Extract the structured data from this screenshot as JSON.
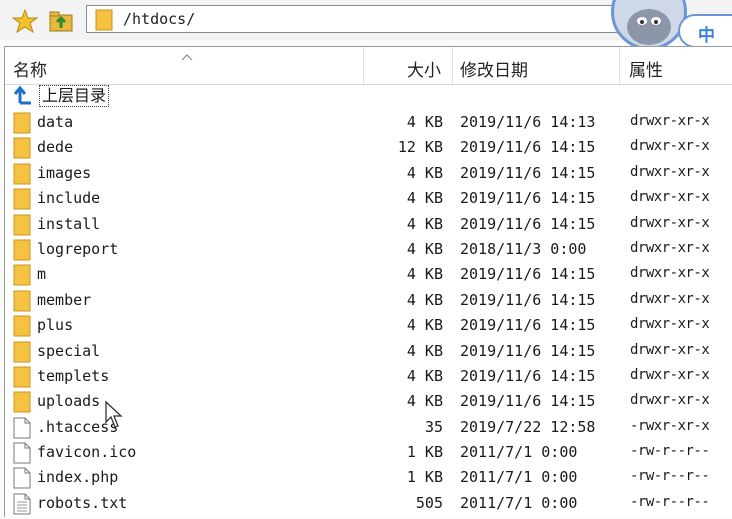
{
  "toolbar": {
    "path": "/htdocs/",
    "icons": [
      "star-icon",
      "up-folder-icon",
      "folder-icon"
    ]
  },
  "ime": {
    "mode_label": "中"
  },
  "header": {
    "name": "名称",
    "size": "大小",
    "modified": "修改日期",
    "attrs": "属性"
  },
  "parent_dir": {
    "label": "上层目录",
    "icon": "up-arrow-icon"
  },
  "files": [
    {
      "name": "data",
      "type": "folder",
      "size": "4 KB",
      "date": "2019/11/6 14:13",
      "perm": "drwxr-xr-x"
    },
    {
      "name": "dede",
      "type": "folder",
      "size": "12 KB",
      "date": "2019/11/6 14:15",
      "perm": "drwxr-xr-x"
    },
    {
      "name": "images",
      "type": "folder",
      "size": "4 KB",
      "date": "2019/11/6 14:15",
      "perm": "drwxr-xr-x"
    },
    {
      "name": "include",
      "type": "folder",
      "size": "4 KB",
      "date": "2019/11/6 14:15",
      "perm": "drwxr-xr-x"
    },
    {
      "name": "install",
      "type": "folder",
      "size": "4 KB",
      "date": "2019/11/6 14:15",
      "perm": "drwxr-xr-x"
    },
    {
      "name": "logreport",
      "type": "folder",
      "size": "4 KB",
      "date": "2018/11/3 0:00",
      "perm": "drwxr-xr-x"
    },
    {
      "name": "m",
      "type": "folder",
      "size": "4 KB",
      "date": "2019/11/6 14:15",
      "perm": "drwxr-xr-x"
    },
    {
      "name": "member",
      "type": "folder",
      "size": "4 KB",
      "date": "2019/11/6 14:15",
      "perm": "drwxr-xr-x"
    },
    {
      "name": "plus",
      "type": "folder",
      "size": "4 KB",
      "date": "2019/11/6 14:15",
      "perm": "drwxr-xr-x"
    },
    {
      "name": "special",
      "type": "folder",
      "size": "4 KB",
      "date": "2019/11/6 14:15",
      "perm": "drwxr-xr-x"
    },
    {
      "name": "templets",
      "type": "folder",
      "size": "4 KB",
      "date": "2019/11/6 14:15",
      "perm": "drwxr-xr-x"
    },
    {
      "name": "uploads",
      "type": "folder",
      "size": "4 KB",
      "date": "2019/11/6 14:15",
      "perm": "drwxr-xr-x"
    },
    {
      "name": ".htaccess",
      "type": "file",
      "size": "35",
      "date": "2019/7/22 12:58",
      "perm": "-rwxr-xr-x"
    },
    {
      "name": "favicon.ico",
      "type": "file",
      "size": "1 KB",
      "date": "2011/7/1 0:00",
      "perm": "-rw-r--r--"
    },
    {
      "name": "index.php",
      "type": "file",
      "size": "1 KB",
      "date": "2011/7/1 0:00",
      "perm": "-rw-r--r--"
    },
    {
      "name": "robots.txt",
      "type": "text-file",
      "size": "505",
      "date": "2011/7/1 0:00",
      "perm": "-rw-r--r--"
    }
  ],
  "colors": {
    "folder": "#f5c242",
    "up_arrow": "#1f6fd1",
    "ime_accent": "#3b82e0"
  }
}
